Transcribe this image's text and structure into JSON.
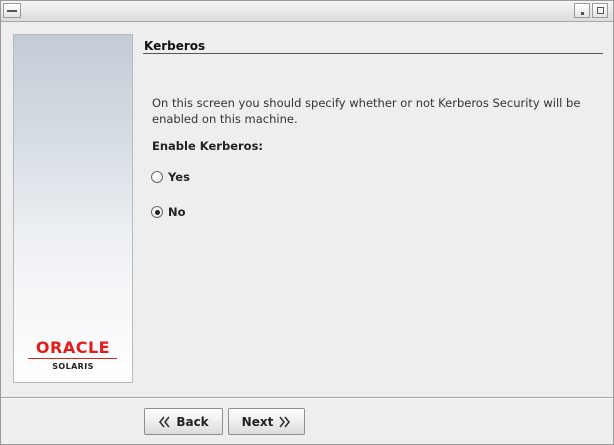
{
  "window": {
    "title": ""
  },
  "branding": {
    "logo_text": "ORACLE",
    "product_text": "SOLARIS",
    "logo_color": "#e21b1b"
  },
  "page": {
    "title": "Kerberos",
    "description": "On this screen you should specify whether or not Kerberos Security will be enabled on this machine.",
    "enable_label": "Enable Kerberos:"
  },
  "options": [
    {
      "label": "Yes",
      "selected": false
    },
    {
      "label": "No",
      "selected": true
    }
  ],
  "buttons": {
    "back_label": "Back",
    "next_label": "Next"
  },
  "icons": {
    "window_menu": "window-menu-icon",
    "minimize": "minimize-icon",
    "maximize": "maximize-icon",
    "back": "double-chevron-left-icon",
    "next": "double-chevron-right-icon"
  }
}
